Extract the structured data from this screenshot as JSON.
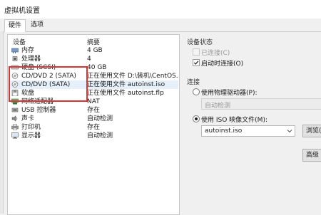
{
  "window": {
    "title": "虚拟机设置"
  },
  "tabs": [
    {
      "label": "硬件"
    },
    {
      "label": "选项"
    }
  ],
  "device_list": {
    "col_device": "设备",
    "col_summary": "摘要",
    "rows": [
      {
        "device": "内存",
        "summary": "4 GB",
        "icon": "memory-icon"
      },
      {
        "device": "处理器",
        "summary": "4",
        "icon": "cpu-icon"
      },
      {
        "device": "硬盘 (SCSI)",
        "summary": "40 GB",
        "icon": "harddisk-icon"
      },
      {
        "device": "CD/DVD 2 (SATA)",
        "summary": "正在使用文件 D:\\装机\\CentOS...",
        "icon": "cd-dvd-icon"
      },
      {
        "device": "CD/DVD (SATA)",
        "summary": "正在使用文件 autoinst.iso",
        "icon": "cd-dvd-icon"
      },
      {
        "device": "软盘",
        "summary": "正在使用文件 autoinst.flp",
        "icon": "floppy-icon"
      },
      {
        "device": "网络适配器",
        "summary": "NAT",
        "icon": "network-adapter-icon"
      },
      {
        "device": "USB 控制器",
        "summary": "存在",
        "icon": "usb-icon"
      },
      {
        "device": "声卡",
        "summary": "自动检测",
        "icon": "sound-card-icon"
      },
      {
        "device": "打印机",
        "summary": "存在",
        "icon": "printer-icon"
      },
      {
        "device": "显示器",
        "summary": "自动检测",
        "icon": "monitor-icon"
      }
    ],
    "selected_index": 4
  },
  "device_status": {
    "label": "设备状态",
    "connected": "已连接(C)",
    "connect_on_power": "启动时连接(O)"
  },
  "connection": {
    "label": "连接",
    "physical_drive": "使用物理驱动器(P):",
    "physical_drive_value": "自动检测",
    "iso_file": "使用 ISO 映像文件(M):",
    "iso_value": "autoinst.iso",
    "browse": "浏览(",
    "advanced": "高级"
  },
  "colors": {
    "highlight": "#d93434",
    "selection": "#e6f0fb"
  }
}
